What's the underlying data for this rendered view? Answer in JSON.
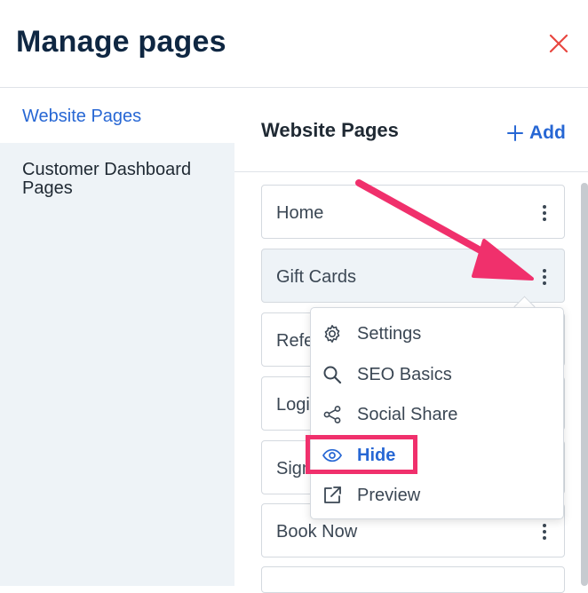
{
  "dialog": {
    "title": "Manage pages",
    "close_icon": "close-icon",
    "close_color": "#e8463f"
  },
  "sidebar": {
    "items": [
      {
        "label": "Website Pages",
        "active": true
      },
      {
        "label": "Customer Dashboard Pages",
        "active": false
      }
    ]
  },
  "main": {
    "title": "Website Pages",
    "add_label": "Add",
    "pages": [
      {
        "label": "Home"
      },
      {
        "label": "Gift Cards",
        "highlighted": true
      },
      {
        "label": "Refe"
      },
      {
        "label": "Logi"
      },
      {
        "label": "Sign"
      },
      {
        "label": "Book Now"
      },
      {
        "label": ""
      }
    ]
  },
  "context_menu": {
    "items": [
      {
        "label": "Settings",
        "icon": "gear-icon"
      },
      {
        "label": "SEO Basics",
        "icon": "search-icon"
      },
      {
        "label": "Social Share",
        "icon": "share-icon"
      },
      {
        "label": "Hide",
        "icon": "eye-icon",
        "active": true
      },
      {
        "label": "Preview",
        "icon": "external-link-icon"
      }
    ]
  },
  "colors": {
    "accent": "#2767d4",
    "annotation": "#f0306c",
    "sidebar_bg": "#eef3f7",
    "title": "#0f2742"
  }
}
